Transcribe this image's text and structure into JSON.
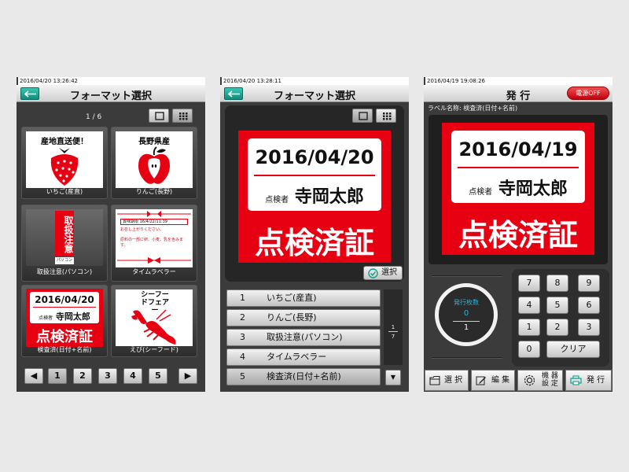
{
  "screen1": {
    "timestamp": "2016/04/20 13:26:42",
    "title": "フォーマット選択",
    "page_indicator": "1  /  6",
    "tiles": [
      {
        "caption": "いちご(産直)",
        "label": "産地直送便！"
      },
      {
        "caption": "りんご(長野)",
        "label": "長野県産"
      },
      {
        "caption": "取扱注意(パソコン)",
        "label_vertical": "取扱注意",
        "sub": "パソコン"
      },
      {
        "caption": "タイムラベラー",
        "expiry_line": "賞味期限 16/4/22/11:39",
        "note1": "お召し上がりください。",
        "note2": "原料の一部に卵、小麦、乳を含みます。"
      },
      {
        "caption": "検査済(日付+名前)",
        "date": "2016/04/20",
        "role": "点検者",
        "name": "寺岡太郎",
        "stamp": "点検済証"
      },
      {
        "caption": "えび(シーフード)",
        "label": "シーフードフェアー"
      }
    ],
    "pages": [
      "1",
      "2",
      "3",
      "4",
      "5"
    ],
    "prev": "◀",
    "next": "▶"
  },
  "screen2": {
    "timestamp": "2016/04/20 13:28:11",
    "title": "フォーマット選択",
    "preview": {
      "date": "2016/04/20",
      "role": "点検者",
      "name": "寺岡太郎",
      "stamp": "点検済証"
    },
    "select_label": "選択",
    "list": [
      {
        "num": "1",
        "text": "いちご(産直)"
      },
      {
        "num": "2",
        "text": "りんご(長野)"
      },
      {
        "num": "3",
        "text": "取扱注意(パソコン)"
      },
      {
        "num": "4",
        "text": "タイムラベラー"
      },
      {
        "num": "5",
        "text": "検査済(日付+名前)"
      }
    ],
    "scroll_page": "1",
    "scroll_total": "7",
    "scroll_down": "▼"
  },
  "screen3": {
    "timestamp": "2016/04/19 19:08:26",
    "title": "発 行",
    "power_button": "電源OFF",
    "label_name": "ラベル名称: 検査済(日付+名前)",
    "preview": {
      "date": "2016/04/19",
      "role": "点検者",
      "name": "寺岡太郎",
      "stamp": "点検済証"
    },
    "count_label": "発行枚数",
    "count_value": "0",
    "count_set": "1",
    "keys": [
      "7",
      "8",
      "9",
      "4",
      "5",
      "6",
      "1",
      "2",
      "3",
      "0"
    ],
    "clear": "クリア",
    "toolbar": {
      "select": "選 択",
      "edit": "編 集",
      "settings_1": "機 器",
      "settings_2": "設 定",
      "issue": "発 行"
    }
  },
  "colors": {
    "label_red": "#e60012",
    "accent_teal": "#13a08c",
    "background": "#3b3b3b"
  }
}
